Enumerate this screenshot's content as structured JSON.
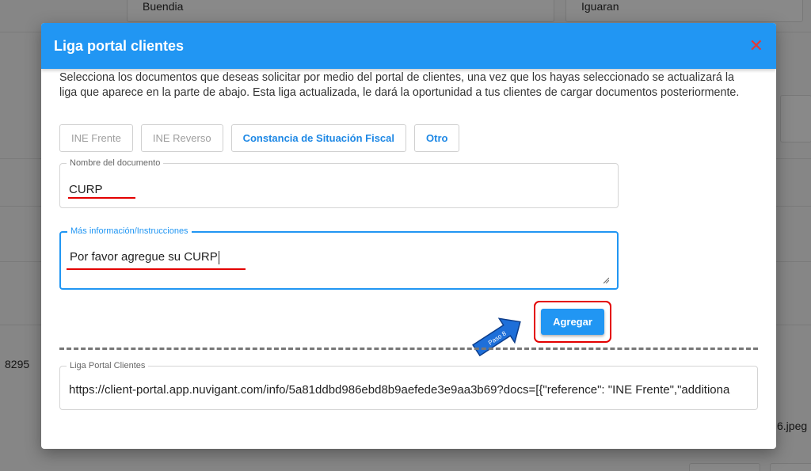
{
  "background": {
    "top_left_value": "Buendia",
    "top_right_value": "Iguaran",
    "left_number": "8295",
    "right_file": "6.jpeg"
  },
  "modal": {
    "title": "Liga portal clientes",
    "close_icon": "close-icon",
    "description": "Selecciona los documentos que deseas solicitar por medio del portal de clientes, una vez que los hayas seleccionado se actualizará la liga que aparece en la parte de abajo. Esta liga actualizada, le dará la oportunidad a tus clientes de cargar documentos posteriormente.",
    "chips": [
      {
        "label": "INE Frente",
        "state": "disabled"
      },
      {
        "label": "INE Reverso",
        "state": "disabled"
      },
      {
        "label": "Constancia de Situación Fiscal",
        "state": "active"
      },
      {
        "label": "Otro",
        "state": "active"
      }
    ],
    "document_name": {
      "label": "Nombre del documento",
      "value": "CURP"
    },
    "instructions": {
      "label": "Más información/Instrucciones",
      "value": "Por favor agregue su CURP"
    },
    "add_button": "Agregar",
    "step_annotation": "Paso 8",
    "portal_link": {
      "label": "Liga Portal Clientes",
      "value": "https://client-portal.app.nuvigant.com/info/5a81ddbd986ebd8b9aefede3e9aa3b69?docs=[{\"reference\": \"INE Frente\",\"additiona"
    }
  },
  "colors": {
    "header": "#2196f3",
    "accent": "#1e88e5",
    "highlight": "#e30000",
    "close": "#e53935"
  }
}
